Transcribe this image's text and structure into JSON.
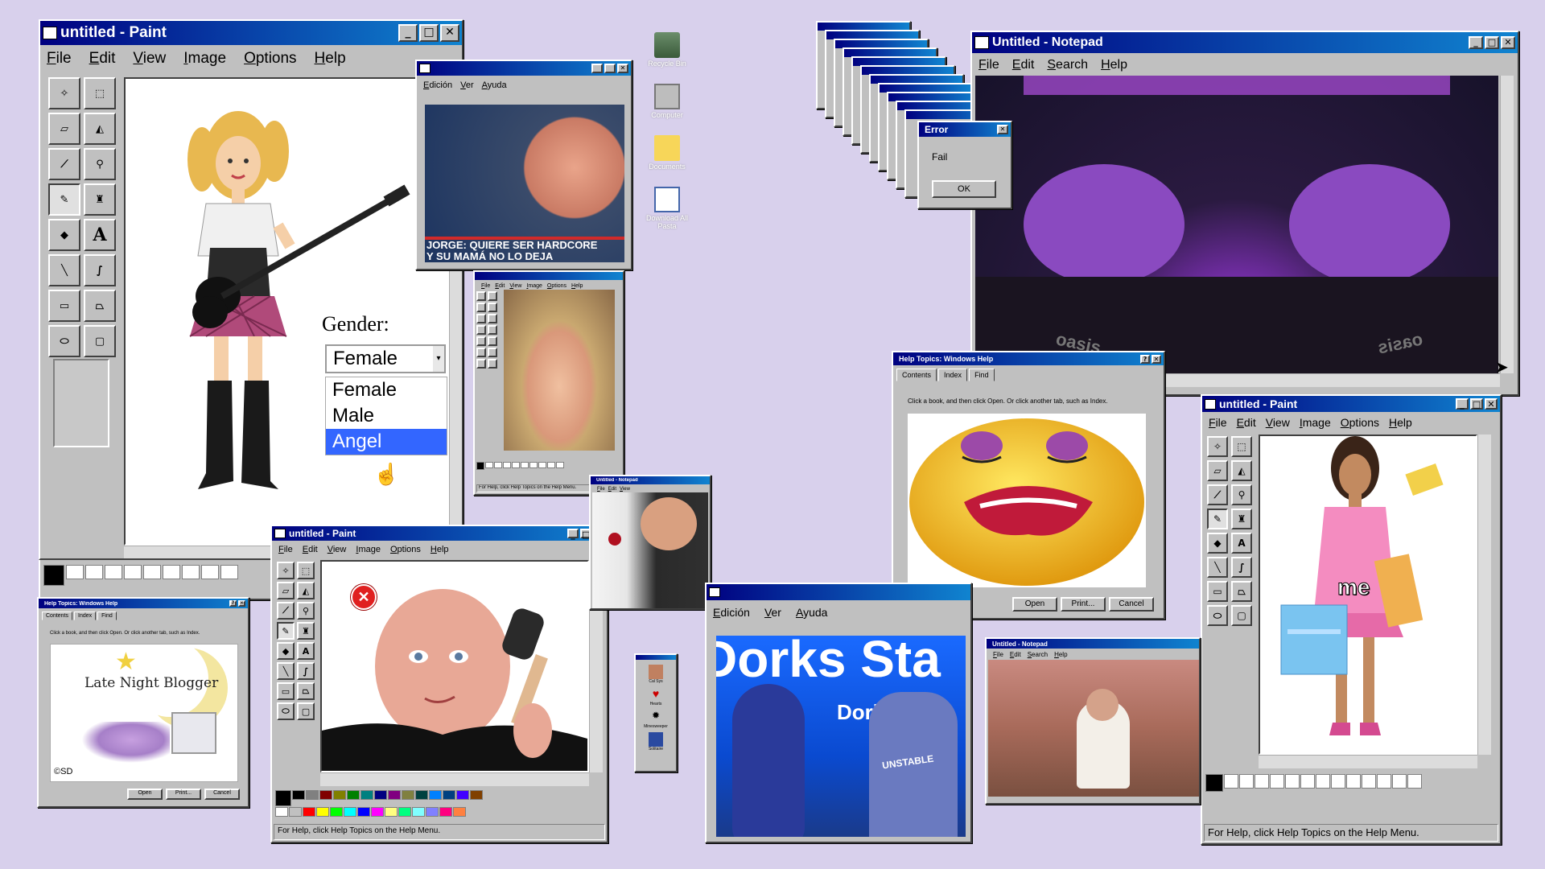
{
  "paint_main": {
    "title": "untitled - Paint",
    "menu": [
      "File",
      "Edit",
      "View",
      "Image",
      "Options",
      "Help"
    ],
    "gender_label": "Gender:",
    "gender_selected": "Female",
    "gender_options": [
      "Female",
      "Male",
      "Angel"
    ],
    "gender_highlight": "Angel"
  },
  "popup_jorge": {
    "menu": [
      "Edición",
      "Ver",
      "Ayuda"
    ],
    "caption_line1": "JORGE: QUIERE SER HARDCORE",
    "caption_line2": "Y SU MAMÁ NO LO DEJA"
  },
  "desktop_icons": [
    {
      "label": "Recycle Bin",
      "icon": "recycle-bin-icon"
    },
    {
      "label": "Computer",
      "icon": "computer-icon"
    },
    {
      "label": "Documents",
      "icon": "folder-icon"
    },
    {
      "label": "Download All Pasta",
      "icon": "calendar-icon"
    }
  ],
  "error_dialog": {
    "title": "Error",
    "message": "Fail",
    "ok": "OK"
  },
  "notepad_main": {
    "title": "Untitled - Notepad",
    "menu": [
      "File",
      "Edit",
      "Search",
      "Help"
    ],
    "shirt_text": "oasis"
  },
  "help_topics_main": {
    "title": "Help Topics: Windows Help",
    "tabs": [
      "Contents",
      "Index",
      "Find"
    ],
    "instructions": "Click a book, and then click Open. Or click another tab, such as Index.",
    "buttons": [
      "Open",
      "Print...",
      "Cancel"
    ]
  },
  "paint_right": {
    "title": "untitled - Paint",
    "menu": [
      "File",
      "Edit",
      "View",
      "Image",
      "Options",
      "Help"
    ],
    "sticker": "me",
    "status": "For Help, click Help Topics on the Help Menu."
  },
  "paint_bottom": {
    "title": "untitled - Paint",
    "menu": [
      "File",
      "Edit",
      "View",
      "Image",
      "Options",
      "Help"
    ],
    "status": "For Help, click Help Topics on the Help Menu."
  },
  "help_small": {
    "title": "Help Topics: Windows Help",
    "tabs": [
      "Contents",
      "Index",
      "Find"
    ],
    "instructions": "Click a book, and then click Open. Or click another tab, such as Index.",
    "logo_text": "Late Night Blogger",
    "copyright": "©SD",
    "buttons": [
      "Open",
      "Print...",
      "Cancel"
    ]
  },
  "paint_tiny": {
    "menu": [
      "File",
      "Edit",
      "View",
      "Image",
      "Options",
      "Help"
    ],
    "status": "For Help, click Help Topics on the Help Menu."
  },
  "notepad_tiny": {
    "title": "Untitled - Notepad",
    "menu": [
      "File",
      "Edit",
      "View"
    ]
  },
  "spanish_window": {
    "menu": [
      "Edición",
      "Ver",
      "Ayuda"
    ],
    "banner": "Dorks Sta",
    "sponsor": "Dori",
    "shirt": "UNSTABLE"
  },
  "notepad_small": {
    "title": "Untitled - Notepad",
    "menu": [
      "File",
      "Edit",
      "Search",
      "Help"
    ]
  },
  "mini_window": {
    "items": [
      "Cal Sys",
      "Hearts",
      "Minesweeper",
      "Solitaire"
    ]
  },
  "colors": {
    "titlebar": "#000080",
    "window_face": "#c0c0c0",
    "desktop": "#d8d0ec",
    "selection": "#3366ff"
  }
}
